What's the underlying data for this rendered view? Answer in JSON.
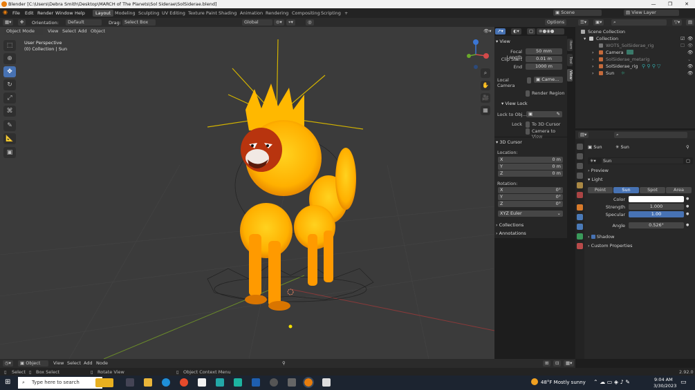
{
  "window": {
    "title": "Blender [C:\\Users\\Debra Smith\\Desktop\\MARCH of The Planets\\Sol Siderae\\SolSiderae.blend]",
    "controls": [
      "—",
      "❐",
      "✕"
    ]
  },
  "menu": [
    "File",
    "Edit",
    "Render",
    "Window",
    "Help"
  ],
  "workspaces": [
    "Layout",
    "Modeling",
    "Sculpting",
    "UV Editing",
    "Texture Paint",
    "Shading",
    "Animation",
    "Rendering",
    "Compositing",
    "Scripting"
  ],
  "active_workspace": "Layout",
  "top_right": {
    "scene": "Scene",
    "view_layer": "View Layer"
  },
  "tool_header": {
    "orientation_label": "Orientation:",
    "orientation_value": "Default",
    "drag_label": "Drag:",
    "drag_value": "Select Box",
    "transform": "Global",
    "options": "Options"
  },
  "viewport_header": {
    "mode": "Object Mode",
    "menus": [
      "View",
      "Select",
      "Add",
      "Object"
    ]
  },
  "viewport": {
    "perspective": "User Perspective",
    "collection": "(0) Collection | Sun"
  },
  "npanel": {
    "view_title": "View",
    "focal_length_label": "Focal Length",
    "focal_length": "50 mm",
    "clip_start_label": "Clip Start",
    "clip_start": "0.01 m",
    "end_label": "End",
    "end": "1000 m",
    "local_camera_label": "Local Camera",
    "local_camera_value": "Came...",
    "render_region": "Render Region",
    "view_lock_title": "View Lock",
    "lock_to_obj_label": "Lock to Obj...",
    "lock_label": "Lock",
    "to_3d_cursor": "To 3D Cursor",
    "camera_to_view": "Camera to View",
    "cursor_title": "3D Cursor",
    "location_label": "Location:",
    "loc_x": "0 m",
    "loc_y": "0 m",
    "loc_z": "0 m",
    "rotation_label": "Rotation:",
    "rot_x": "0°",
    "rot_y": "0°",
    "rot_z": "0°",
    "rotation_mode": "XYZ Euler",
    "collections": "Collections",
    "annotations": "Annotations",
    "tabs": [
      "Item",
      "Tool",
      "View"
    ]
  },
  "outliner": {
    "root": "Scene Collection",
    "items": [
      {
        "name": "Collection",
        "color": "#c8c8c8"
      },
      {
        "name": "WOTS_SolSiderae_rig",
        "color": "#777777"
      },
      {
        "name": "Camera",
        "color": "#c46a3b"
      },
      {
        "name": "SolSiderae_metarig",
        "color": "#c46a3b"
      },
      {
        "name": "SolSiderae_rig",
        "color": "#c46a3b"
      },
      {
        "name": "Sun",
        "color": "#c46a3b"
      }
    ]
  },
  "properties": {
    "object_name": "Sun",
    "data_name": "Sun",
    "datablock": "Sun",
    "preview": "Preview",
    "light": "Light",
    "light_types": [
      "Point",
      "Sun",
      "Spot",
      "Area"
    ],
    "active_type": "Sun",
    "color_label": "Color",
    "color": "#ffffff",
    "strength_label": "Strength",
    "strength": "1.000",
    "specular_label": "Specular",
    "specular": "1.00",
    "angle_label": "Angle",
    "angle": "0.526°",
    "shadow": "Shadow",
    "custom_properties": "Custom Properties"
  },
  "timeline_header": {
    "mode": "Object",
    "menus": [
      "View",
      "Select",
      "Add",
      "Node"
    ]
  },
  "status": {
    "select": "Select",
    "box_select": "Box Select",
    "rotate_view": "Rotate View",
    "context_menu": "Object Context Menu",
    "version": "2.92.0"
  },
  "taskbar": {
    "search_placeholder": "Type here to search",
    "weather": "48°F  Mostly sunny",
    "time": "9:04 AM",
    "date": "3/30/2023"
  },
  "colors": {
    "accent": "#4772b3",
    "blender_orange": "#e87d0d"
  }
}
